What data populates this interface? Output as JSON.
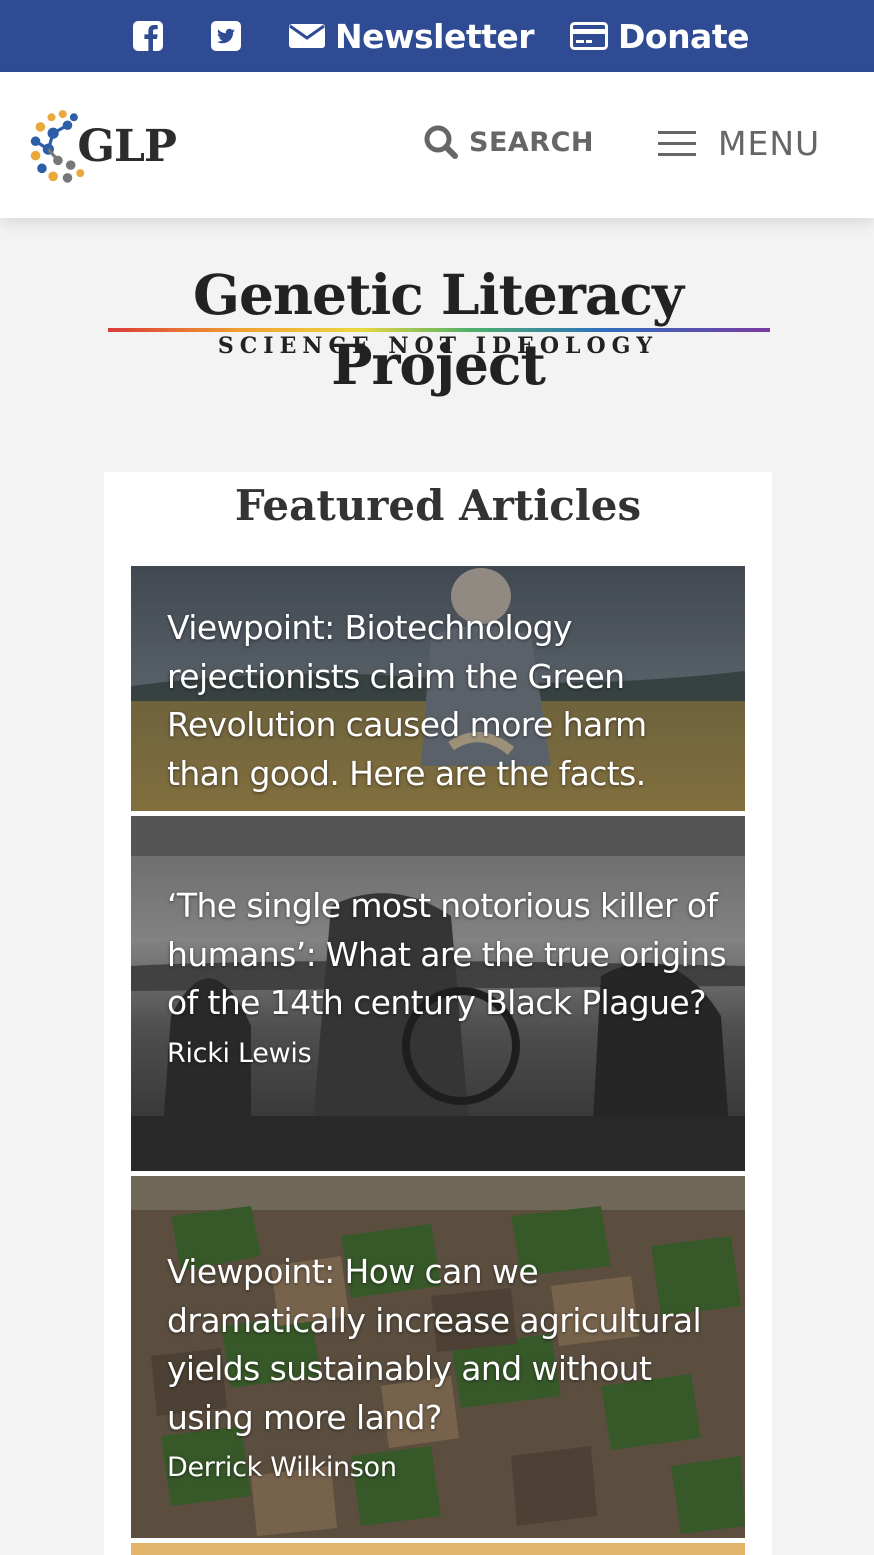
{
  "topbar": {
    "facebook_icon": "facebook-square-icon",
    "twitter_icon": "twitter-square-icon",
    "newsletter_label": "Newsletter",
    "donate_label": "Donate",
    "bg_color": "#2f4b93"
  },
  "header": {
    "logo_text": "GLP",
    "search_label": "SEARCH",
    "menu_label": "MENU"
  },
  "masthead": {
    "title": "Genetic Literacy Project",
    "tagline": "SCIENCE NOT IDEOLOGY"
  },
  "featured": {
    "title": "Featured Articles",
    "articles": [
      {
        "headline": "Viewpoint: Biotechnology rejectionists claim the Green Revolution caused more harm than good. Here are the facts.",
        "author": ""
      },
      {
        "headline": "‘The single most notorious killer of humans’: What are the true origins of the 14th century Black Plague?",
        "author": "Ricki Lewis"
      },
      {
        "headline": "Viewpoint: How can we dramatically increase agricultural yields sustainably and without using more land?",
        "author": "Derrick Wilkinson"
      }
    ]
  }
}
